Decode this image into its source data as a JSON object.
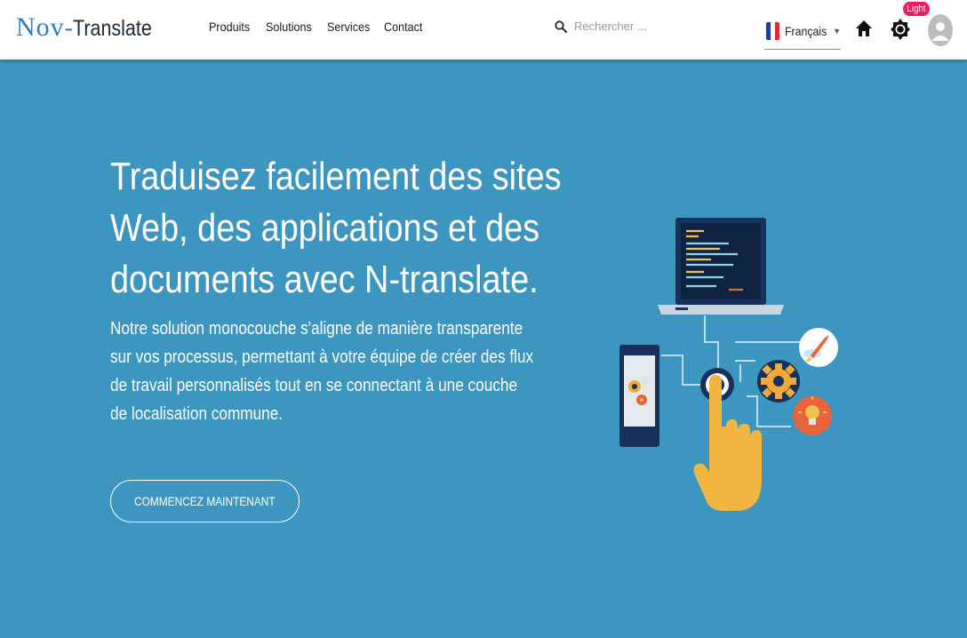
{
  "header": {
    "logo": {
      "part1": "Nov",
      "dash": "-",
      "part2": "Translate"
    },
    "nav": {
      "produits": "Produits",
      "solutions": "Solutions",
      "services": "Services",
      "contact": "Contact"
    },
    "search": {
      "placeholder": "Rechercher ..."
    },
    "language": {
      "selected": "Français"
    },
    "theme_badge": "Light"
  },
  "hero": {
    "title_line1": "Traduisez facilement des sites",
    "title_line2": "Web, des applications et des",
    "title_line3": "documents avec N-translate.",
    "description": "Notre solution monocouche s'aligne de manière transparente sur vos processus, permettant à votre équipe de créer des flux de travail personnalisés tout en se connectant à une couche de localisation commune.",
    "cta_label": "COMMENCEZ MAINTENANT"
  },
  "colors": {
    "hero_bg": "#3c96bf",
    "logo_accent": "#2a7fc1",
    "badge": "#e91e63"
  },
  "icons": [
    "search-icon",
    "france-flag-icon",
    "chevron-down-icon",
    "home-icon",
    "brightness-icon",
    "avatar-icon"
  ]
}
